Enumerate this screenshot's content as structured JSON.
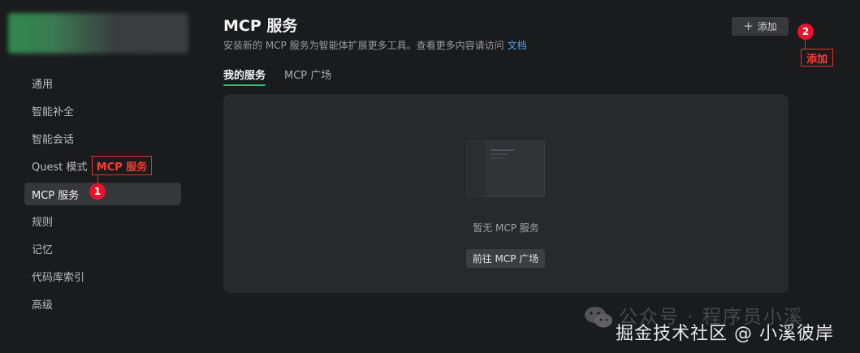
{
  "sidebar": {
    "items": [
      {
        "label": "通用"
      },
      {
        "label": "智能补全"
      },
      {
        "label": "智能会话"
      },
      {
        "label": "Quest 模式"
      },
      {
        "label": "MCP 服务"
      },
      {
        "label": "规则"
      },
      {
        "label": "记忆"
      },
      {
        "label": "代码库索引"
      },
      {
        "label": "高级"
      }
    ],
    "active_index": 4
  },
  "header": {
    "title": "MCP 服务",
    "subtitle": "安装新的 MCP 服务为智能体扩展更多工具。查看更多内容请访问",
    "docs_link": "文档",
    "add_label": "添加"
  },
  "tabs": [
    {
      "label": "我的服务",
      "active": true
    },
    {
      "label": "MCP 广场",
      "active": false
    }
  ],
  "empty_state": {
    "message": "暂无 MCP 服务",
    "button_label": "前往 MCP 广场"
  },
  "annotations": {
    "label_1": "MCP 服务",
    "badge_1": "1",
    "label_2": "添加",
    "badge_2": "2"
  },
  "watermark": {
    "back_text": "公众号 · 程序员小溪",
    "front_text": "掘金技术社区 @ 小溪彼岸"
  },
  "colors": {
    "background": "#1a1b1d",
    "panel": "#28292c",
    "accent_tab": "#2fbf71",
    "link": "#4aa3f5",
    "annotation_red": "#e8132c"
  }
}
